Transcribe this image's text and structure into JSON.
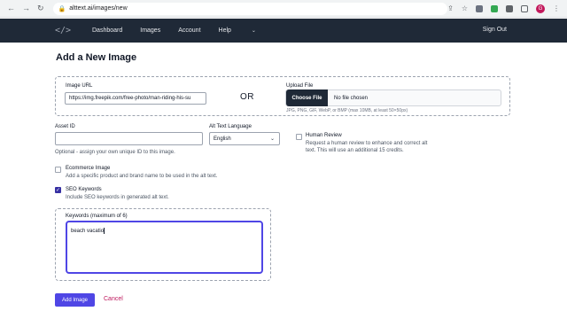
{
  "browser": {
    "url": "alttext.ai/images/new",
    "profile_initial": "G"
  },
  "nav": {
    "logo_text": "</>",
    "links": [
      "Dashboard",
      "Images",
      "Account",
      "Help"
    ],
    "sign_out": "Sign Out"
  },
  "page": {
    "title": "Add a New Image"
  },
  "image_url": {
    "label": "Image URL",
    "value": "https://img.freepik.com/free-photo/man-riding-his-su"
  },
  "or_label": "OR",
  "upload": {
    "label": "Upload File",
    "button": "Choose File",
    "status": "No file chosen",
    "hint": "JPG, PNG, GIF, WebP, or BMP (max 10MB, at least 50×50px)"
  },
  "asset_id": {
    "label": "Asset ID",
    "value": "",
    "hint": "Optional - assign your own unique ID to this image."
  },
  "language": {
    "label": "Alt Text Language",
    "selected": "English"
  },
  "human_review": {
    "label": "Human Review",
    "checked": false,
    "description_1": "Request a human review to enhance and correct alt",
    "description_2": "text. This will use an additional 15 credits."
  },
  "ecommerce": {
    "label": "Ecommerce Image",
    "checked": false,
    "description": "Add a specific product and brand name to be used in the alt text."
  },
  "seo": {
    "label": "SEO Keywords",
    "checked": true,
    "description": "Include SEO keywords in generated alt text."
  },
  "keywords": {
    "label": "Keywords (maximum of 6)",
    "value": "beach vacatio"
  },
  "actions": {
    "submit": "Add Image",
    "cancel": "Cancel"
  },
  "colors": {
    "nav_bg": "#1f2937",
    "primary": "#4f46e5",
    "cancel": "#be185d"
  }
}
